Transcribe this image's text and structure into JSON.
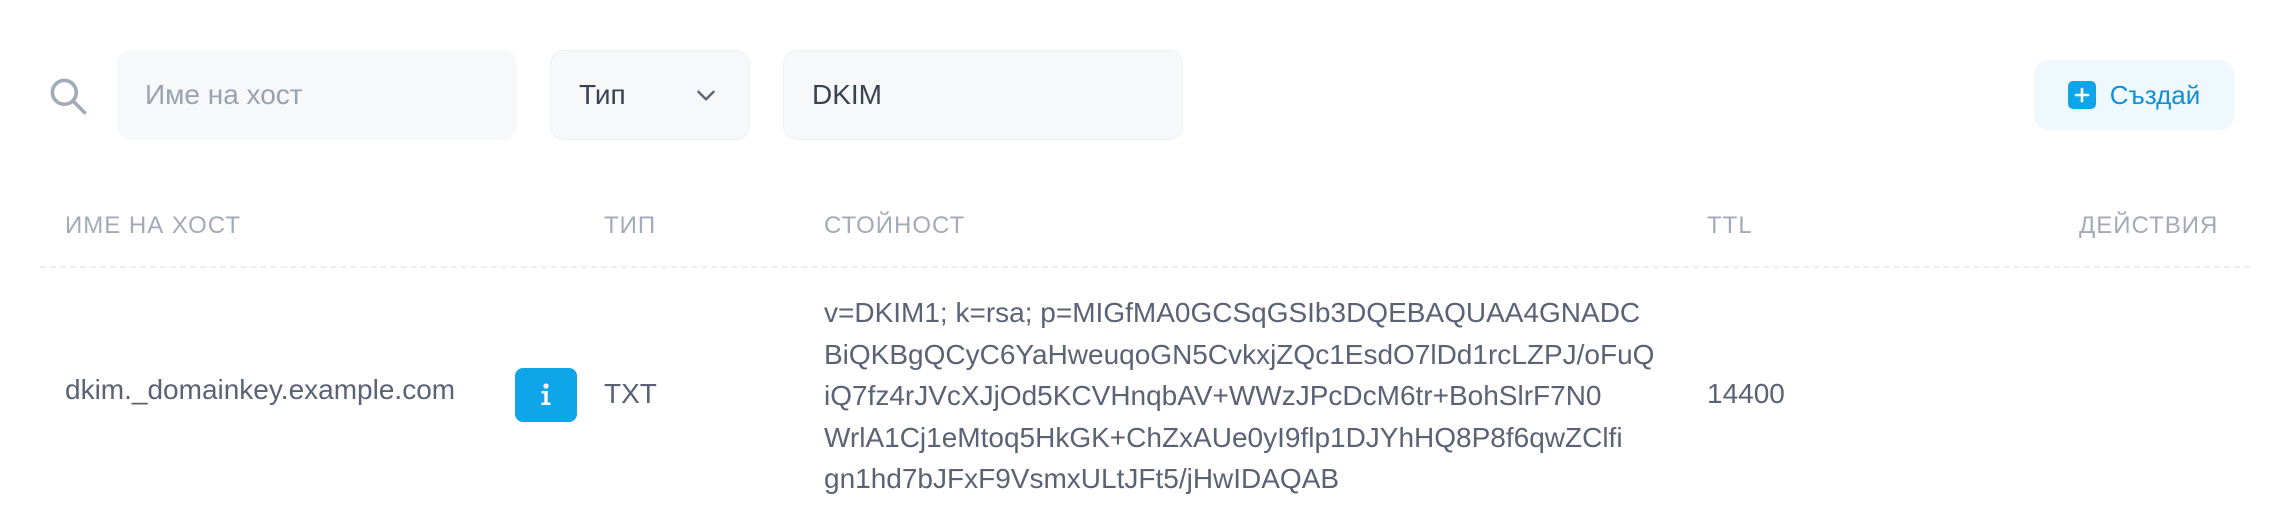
{
  "filters": {
    "host_placeholder": "Име на хост",
    "type_value": "Тип",
    "value_filter": "DKIM"
  },
  "create_button_label": "Създай",
  "table": {
    "columns": [
      "Име на хост",
      "Тип",
      "Стойност",
      "TTL",
      "Действия"
    ],
    "rows": [
      {
        "host": "dkim._domainkey.example.com",
        "type": "TXT",
        "value_lines": [
          "v=DKIM1; k=rsa; p=MIGfMA0GCSqGSIb3DQEBAQUAA4GNADC",
          "BiQKBgQCyC6YaHweuqoGN5CvkxjZQc1EsdO7lDd1rcLZPJ/oFuQ",
          "iQ7fz4rJVcXJjOd5KCVHnqbAV+WWzJPcDcM6tr+BohSlrF7N0",
          "WrlA1Cj1eMtoq5HkGK+ChZxAUe0yI9flp1DJYhHQ8P8f6qwZClfi",
          "gn1hd7bJFxF9VsmxULtJFt5/jHwIDAQAB"
        ],
        "ttl": "14400"
      }
    ]
  },
  "colors": {
    "accent": "#0ea5e9",
    "text": "#5b6275",
    "muted": "#a4aab7"
  }
}
